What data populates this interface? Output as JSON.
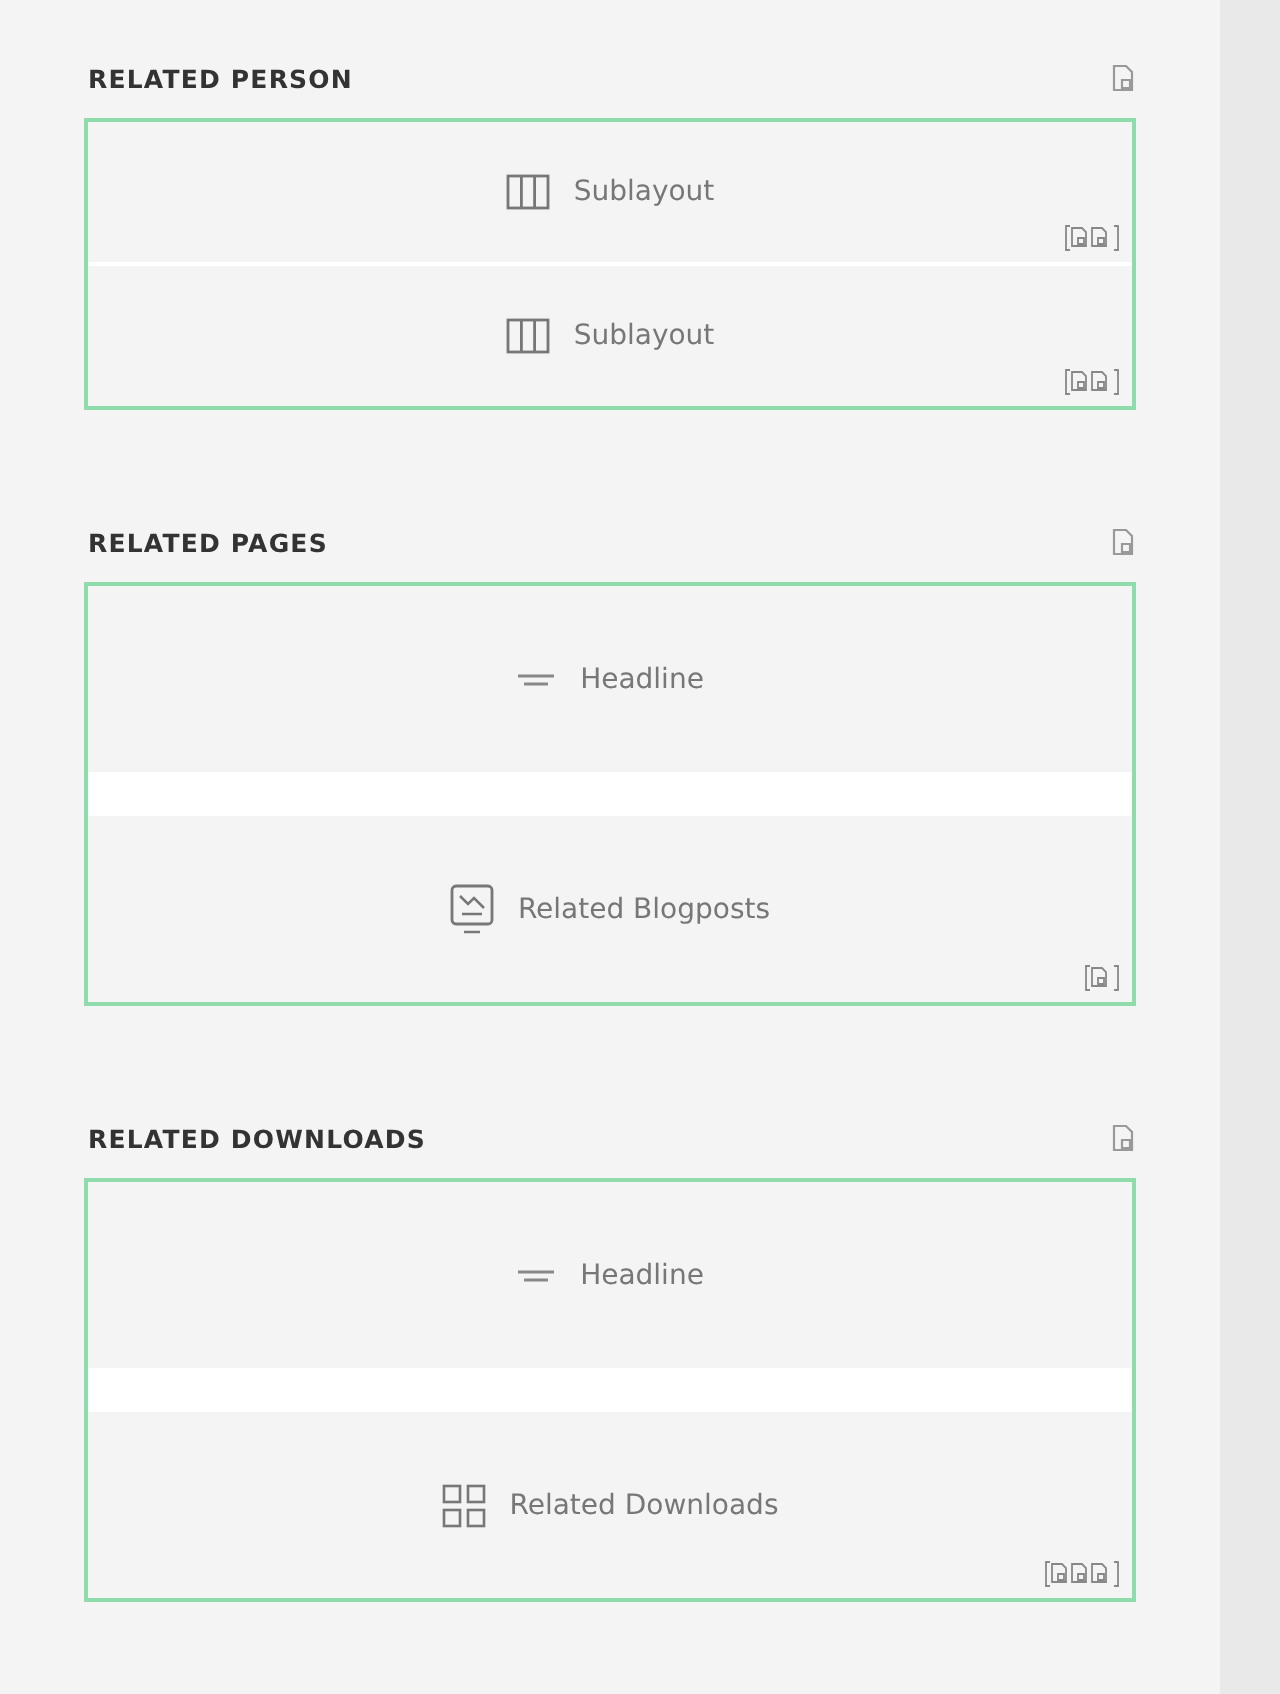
{
  "sections": [
    {
      "title": "RELATED PERSON",
      "items": [
        {
          "label": "Sublayout",
          "kind": "sublayout",
          "indicators": [
            {
              "kind": "page"
            },
            {
              "kind": "page"
            }
          ]
        },
        {
          "label": "Sublayout",
          "kind": "sublayout",
          "indicators": [
            {
              "kind": "page"
            },
            {
              "kind": "page"
            }
          ]
        }
      ]
    },
    {
      "title": "RELATED PAGES",
      "items": [
        {
          "label": "Headline",
          "kind": "headline"
        },
        {
          "label": "Related Blogposts",
          "kind": "blogposts",
          "indicators": [
            {
              "kind": "page"
            }
          ]
        }
      ]
    },
    {
      "title": "RELATED DOWNLOADS",
      "items": [
        {
          "label": "Headline",
          "kind": "headline"
        },
        {
          "label": "Related Downloads",
          "kind": "downloads",
          "indicators": [
            {
              "kind": "page"
            },
            {
              "kind": "page"
            },
            {
              "kind": "page"
            }
          ]
        }
      ]
    }
  ]
}
